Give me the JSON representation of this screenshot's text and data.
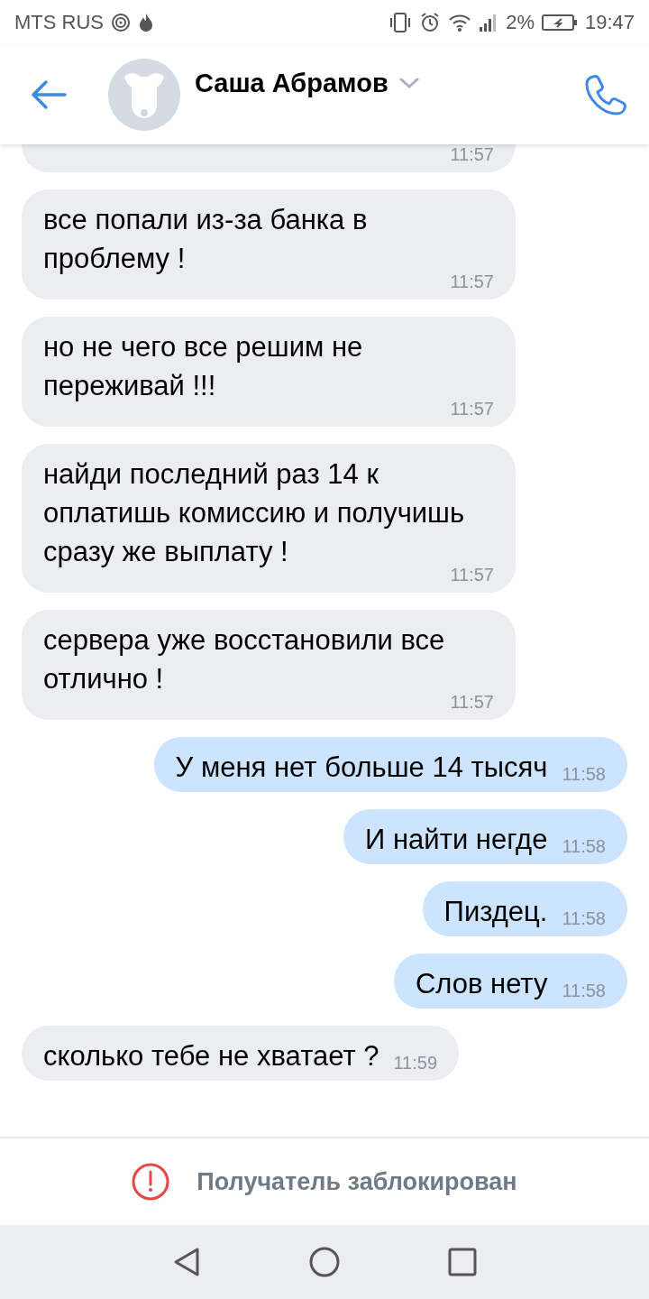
{
  "status_bar": {
    "carrier": "MTS RUS",
    "battery": "2%",
    "time": "19:47"
  },
  "header": {
    "name": "Саша Абрамов"
  },
  "messages": [
    {
      "kind": "incoming",
      "time": "11:57"
    },
    {
      "kind": "incoming",
      "text": "все попали из-за банка в проблему !",
      "time": "11:57"
    },
    {
      "kind": "incoming",
      "text": "но не чего все решим не переживай !!!",
      "time": "11:57"
    },
    {
      "kind": "incoming",
      "text": "найди последний раз 14 к оплатишь комиссию и получишь сразу же выплату !",
      "time": "11:57"
    },
    {
      "kind": "incoming",
      "text": "сервера уже восстановили все отлично !",
      "time": "11:57"
    },
    {
      "kind": "outgoing",
      "text": "У меня нет больше 14 тысяч",
      "time": "11:58"
    },
    {
      "kind": "outgoing",
      "text": "И найти негде",
      "time": "11:58"
    },
    {
      "kind": "outgoing",
      "text": "Пиздец.",
      "time": "11:58"
    },
    {
      "kind": "outgoing",
      "text": "Слов нету",
      "time": "11:58"
    },
    {
      "kind": "incoming",
      "text": "сколько тебе не хватает ?",
      "time": "11:59"
    }
  ],
  "blocked_notice": "Получатель заблокирован"
}
